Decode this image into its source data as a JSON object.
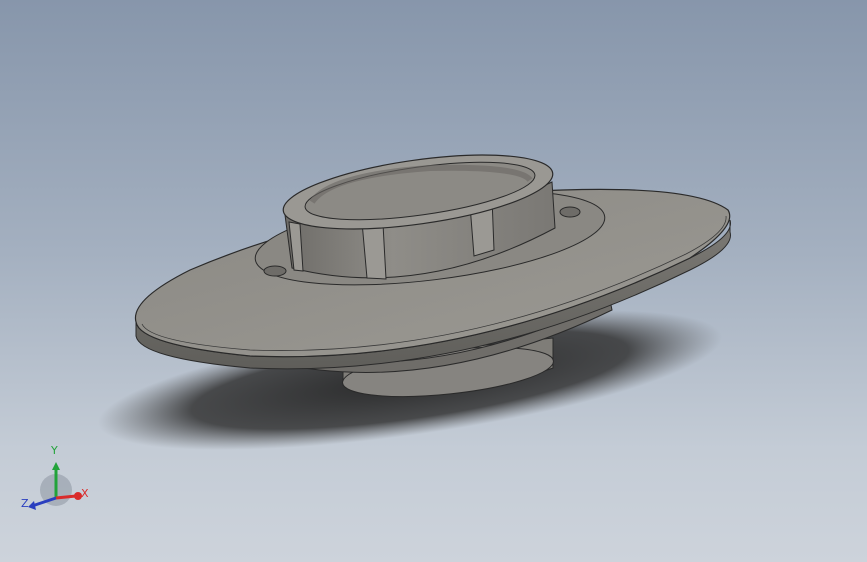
{
  "viewport": {
    "background_top": "#8796ab",
    "background_bottom": "#cdd3db"
  },
  "model": {
    "part": "flanged-hub",
    "color": "#8e8c87"
  },
  "triad": {
    "x_label": "X",
    "y_label": "Y",
    "z_label": "Z",
    "x_color": "#d92b2b",
    "y_color": "#22a33a",
    "z_color": "#2a3fbf"
  }
}
